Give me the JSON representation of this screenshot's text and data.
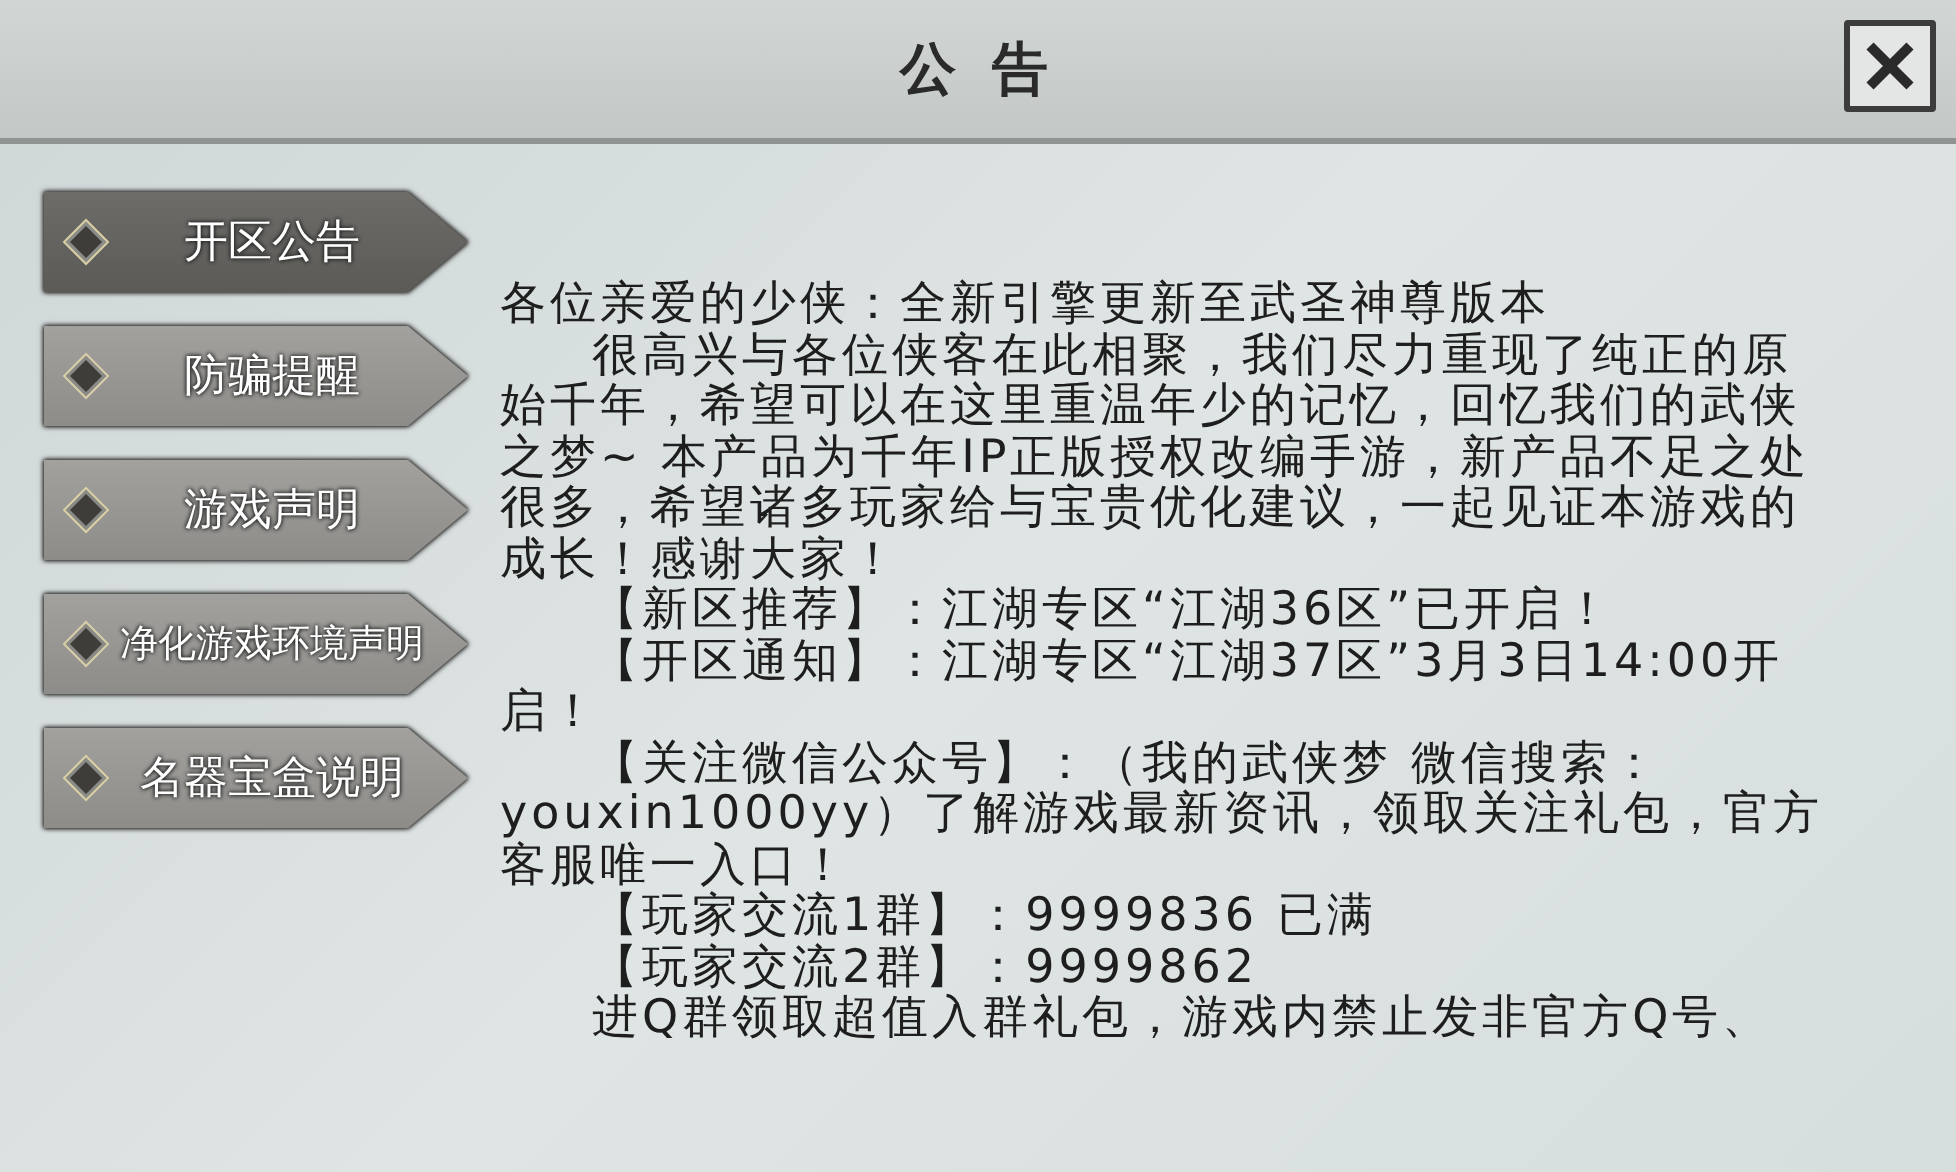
{
  "window": {
    "title": "公 告"
  },
  "tabs": [
    {
      "label": "开区公告",
      "selected": true
    },
    {
      "label": "防骗提醒",
      "selected": false
    },
    {
      "label": "游戏声明",
      "selected": false
    },
    {
      "label": "净化游戏环境声明",
      "selected": false
    },
    {
      "label": "名器宝盒说明",
      "selected": false
    }
  ],
  "announcement": {
    "paragraphs": [
      {
        "text": "各位亲爱的少侠：全新引擎更新至武圣神尊版本",
        "indented": false
      },
      {
        "text": "很高兴与各位侠客在此相聚，我们尽力重现了纯正的原始千年，希望可以在这里重温年少的记忆，回忆我们的武侠之梦~ 本产品为千年IP正版授权改编手游，新产品不足之处很多，希望诸多玩家给与宝贵优化建议，一起见证本游戏的成长！感谢大家！",
        "indented": true
      },
      {
        "text": "【新区推荐】：江湖专区“江湖36区”已开启！",
        "indented": true
      },
      {
        "text": "【开区通知】：江湖专区“江湖37区”3月3日14:00开启！",
        "indented": true
      },
      {
        "text": "【关注微信公众号】：（我的武侠梦 微信搜索：youxin1000yy）了解游戏最新资讯，领取关注礼包，官方客服唯一入口！",
        "indented": true
      },
      {
        "text": "【玩家交流1群】：9999836 已满",
        "indented": true
      },
      {
        "text": "【玩家交流2群】：9999862",
        "indented": true
      },
      {
        "text": "进Q群领取超值入群礼包，游戏内禁止发非官方Q号、",
        "indented": true
      }
    ]
  }
}
